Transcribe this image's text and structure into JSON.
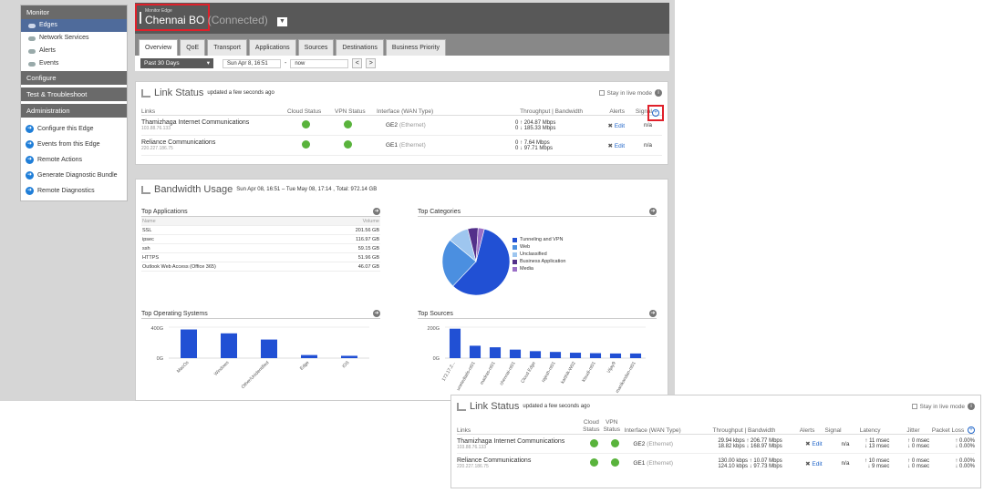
{
  "sidebar": {
    "monitor": "Monitor",
    "items": [
      "Edges",
      "Network Services",
      "Alerts",
      "Events"
    ],
    "configure": "Configure",
    "test": "Test & Troubleshoot",
    "administration": "Administration",
    "actions": [
      "Configure this Edge",
      "Events from this Edge",
      "Remote Actions",
      "Generate Diagnostic Bundle",
      "Remote Diagnostics"
    ]
  },
  "header": {
    "sub": "Monitor Edge",
    "name": "Chennai BO",
    "status": "(Connected)"
  },
  "tabs": [
    "Overview",
    "QoE",
    "Transport",
    "Applications",
    "Sources",
    "Destinations",
    "Business Priority"
  ],
  "datebar": {
    "range": "Past 30 Days",
    "start": "Sun Apr 8, 16:51",
    "dash": "-",
    "end": "now",
    "prev": "<",
    "next": ">"
  },
  "link_status": {
    "title": "Link Status",
    "updated": "updated a few seconds ago",
    "live_mode": "Stay in live mode",
    "headers": {
      "links": "Links",
      "cloud": "Cloud Status",
      "vpn": "VPN Status",
      "iface": "Interface (WAN Type)",
      "throughput": "Throughput | Bandwidth",
      "alerts": "Alerts",
      "signal": "Signal"
    },
    "rows": [
      {
        "name": "Thamizhaga Internet Communications",
        "ip": "103.88.76.133",
        "iface": "GE2",
        "type": "(Ethernet)",
        "up_t": "0",
        "up_b": "204.87 Mbps",
        "dn_t": "0",
        "dn_b": "185.33 Mbps",
        "edit": "Edit",
        "signal": "n/a"
      },
      {
        "name": "Reliance Communications",
        "ip": "220.227.186.75",
        "iface": "GE1",
        "type": "(Ethernet)",
        "up_t": "0",
        "up_b": "7.64 Mbps",
        "dn_t": "0",
        "dn_b": "97.71 Mbps",
        "edit": "Edit",
        "signal": "n/a"
      }
    ]
  },
  "bandwidth": {
    "title": "Bandwidth Usage",
    "period": "Sun Apr 08, 16:51 – Tue May 08, 17:14 , Total: 972.14 GB",
    "top_apps": {
      "title": "Top Applications",
      "name_h": "Name",
      "vol_h": "Volume",
      "rows": [
        {
          "name": "SSL",
          "vol": "201.56 GB"
        },
        {
          "name": "ipsec",
          "vol": "116.97 GB"
        },
        {
          "name": "ssh",
          "vol": "59.15 GB"
        },
        {
          "name": "HTTPS",
          "vol": "51.96 GB"
        },
        {
          "name": "Outlook Web Access (Office 365)",
          "vol": "46.07 GB"
        }
      ]
    },
    "top_categories": {
      "title": "Top Categories",
      "legend": [
        "Tunneling and VPN",
        "Web",
        "Unclassified",
        "Business Application",
        "Media"
      ]
    },
    "top_os": {
      "title": "Top Operating Systems"
    },
    "top_sources": {
      "title": "Top Sources"
    }
  },
  "zoom": {
    "title": "Link Status",
    "updated": "updated a few seconds ago",
    "live_mode": "Stay in live mode",
    "headers": {
      "links": "Links",
      "cloud": "Cloud Status",
      "vpn": "VPN Status",
      "iface": "Interface (WAN Type)",
      "throughput": "Throughput | Bandwidth",
      "alerts": "Alerts",
      "signal": "Signal",
      "latency": "Latency",
      "jitter": "Jitter",
      "loss": "Packet Loss"
    },
    "rows": [
      {
        "name": "Thamizhaga Internet Communications",
        "ip": "103.88.76.133",
        "iface": "GE2",
        "type": "(Ethernet)",
        "up_t": "29.94 kbps",
        "up_b": "206.77 Mbps",
        "dn_t": "18.82 kbps",
        "dn_b": "168.97 Mbps",
        "edit": "Edit",
        "signal": "n/a",
        "lat_up": "11 msec",
        "lat_dn": "13 msec",
        "jit_up": "0 msec",
        "jit_dn": "0 msec",
        "loss_up": "0.00%",
        "loss_dn": "0.00%"
      },
      {
        "name": "Reliance Communications",
        "ip": "220.227.186.75",
        "iface": "GE1",
        "type": "(Ethernet)",
        "up_t": "130.00 kbps",
        "up_b": "10.07 Mbps",
        "dn_t": "124.10 kbps",
        "dn_b": "97.73 Mbps",
        "edit": "Edit",
        "signal": "n/a",
        "lat_up": "10 msec",
        "lat_dn": "9 msec",
        "jit_up": "0 msec",
        "jit_dn": "0 msec",
        "loss_up": "0.00%",
        "loss_dn": "0.00%"
      }
    ]
  },
  "chart_data": [
    {
      "type": "pie",
      "title": "Top Categories",
      "categories": [
        "Tunneling and VPN",
        "Web",
        "Unclassified",
        "Business Application",
        "Media"
      ],
      "values": [
        58,
        24,
        10,
        5,
        3
      ],
      "colors": [
        "#2150d4",
        "#4b8fe0",
        "#9ec6ef",
        "#53308a",
        "#9b6fc7"
      ]
    },
    {
      "type": "bar",
      "title": "Top Operating Systems",
      "categories": [
        "MacOs",
        "Windows",
        "Other/Unidentified",
        "Edge",
        "iOS"
      ],
      "values": [
        370,
        320,
        240,
        40,
        30
      ],
      "yticks": [
        "400G",
        "0G"
      ],
      "ylim": [
        0,
        400
      ],
      "color": "#2150d4"
    },
    {
      "type": "bar",
      "title": "Top Sources",
      "categories": [
        "172.17.2...",
        "unetedtails-nt01",
        "madras-nt01",
        "chennai-nt01",
        "Cloud Edge",
        "rajesh-nt01",
        "karthik-W02",
        "ktsudi-nt01",
        "Vijay9",
        "manikandan-nt01"
      ],
      "values": [
        190,
        80,
        70,
        55,
        45,
        40,
        35,
        32,
        30,
        30
      ],
      "yticks": [
        "200G",
        "0G"
      ],
      "ylim": [
        0,
        200
      ],
      "color": "#2150d4"
    }
  ]
}
